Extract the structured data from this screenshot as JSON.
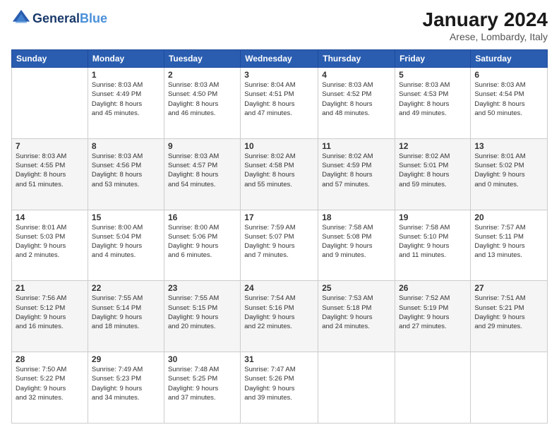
{
  "header": {
    "logo_line1": "General",
    "logo_line2": "Blue",
    "month_title": "January 2024",
    "location": "Arese, Lombardy, Italy"
  },
  "days_of_week": [
    "Sunday",
    "Monday",
    "Tuesday",
    "Wednesday",
    "Thursday",
    "Friday",
    "Saturday"
  ],
  "weeks": [
    [
      {
        "num": "",
        "info": ""
      },
      {
        "num": "1",
        "info": "Sunrise: 8:03 AM\nSunset: 4:49 PM\nDaylight: 8 hours\nand 45 minutes."
      },
      {
        "num": "2",
        "info": "Sunrise: 8:03 AM\nSunset: 4:50 PM\nDaylight: 8 hours\nand 46 minutes."
      },
      {
        "num": "3",
        "info": "Sunrise: 8:04 AM\nSunset: 4:51 PM\nDaylight: 8 hours\nand 47 minutes."
      },
      {
        "num": "4",
        "info": "Sunrise: 8:03 AM\nSunset: 4:52 PM\nDaylight: 8 hours\nand 48 minutes."
      },
      {
        "num": "5",
        "info": "Sunrise: 8:03 AM\nSunset: 4:53 PM\nDaylight: 8 hours\nand 49 minutes."
      },
      {
        "num": "6",
        "info": "Sunrise: 8:03 AM\nSunset: 4:54 PM\nDaylight: 8 hours\nand 50 minutes."
      }
    ],
    [
      {
        "num": "7",
        "info": "Sunrise: 8:03 AM\nSunset: 4:55 PM\nDaylight: 8 hours\nand 51 minutes."
      },
      {
        "num": "8",
        "info": "Sunrise: 8:03 AM\nSunset: 4:56 PM\nDaylight: 8 hours\nand 53 minutes."
      },
      {
        "num": "9",
        "info": "Sunrise: 8:03 AM\nSunset: 4:57 PM\nDaylight: 8 hours\nand 54 minutes."
      },
      {
        "num": "10",
        "info": "Sunrise: 8:02 AM\nSunset: 4:58 PM\nDaylight: 8 hours\nand 55 minutes."
      },
      {
        "num": "11",
        "info": "Sunrise: 8:02 AM\nSunset: 4:59 PM\nDaylight: 8 hours\nand 57 minutes."
      },
      {
        "num": "12",
        "info": "Sunrise: 8:02 AM\nSunset: 5:01 PM\nDaylight: 8 hours\nand 59 minutes."
      },
      {
        "num": "13",
        "info": "Sunrise: 8:01 AM\nSunset: 5:02 PM\nDaylight: 9 hours\nand 0 minutes."
      }
    ],
    [
      {
        "num": "14",
        "info": "Sunrise: 8:01 AM\nSunset: 5:03 PM\nDaylight: 9 hours\nand 2 minutes."
      },
      {
        "num": "15",
        "info": "Sunrise: 8:00 AM\nSunset: 5:04 PM\nDaylight: 9 hours\nand 4 minutes."
      },
      {
        "num": "16",
        "info": "Sunrise: 8:00 AM\nSunset: 5:06 PM\nDaylight: 9 hours\nand 6 minutes."
      },
      {
        "num": "17",
        "info": "Sunrise: 7:59 AM\nSunset: 5:07 PM\nDaylight: 9 hours\nand 7 minutes."
      },
      {
        "num": "18",
        "info": "Sunrise: 7:58 AM\nSunset: 5:08 PM\nDaylight: 9 hours\nand 9 minutes."
      },
      {
        "num": "19",
        "info": "Sunrise: 7:58 AM\nSunset: 5:10 PM\nDaylight: 9 hours\nand 11 minutes."
      },
      {
        "num": "20",
        "info": "Sunrise: 7:57 AM\nSunset: 5:11 PM\nDaylight: 9 hours\nand 13 minutes."
      }
    ],
    [
      {
        "num": "21",
        "info": "Sunrise: 7:56 AM\nSunset: 5:12 PM\nDaylight: 9 hours\nand 16 minutes."
      },
      {
        "num": "22",
        "info": "Sunrise: 7:55 AM\nSunset: 5:14 PM\nDaylight: 9 hours\nand 18 minutes."
      },
      {
        "num": "23",
        "info": "Sunrise: 7:55 AM\nSunset: 5:15 PM\nDaylight: 9 hours\nand 20 minutes."
      },
      {
        "num": "24",
        "info": "Sunrise: 7:54 AM\nSunset: 5:16 PM\nDaylight: 9 hours\nand 22 minutes."
      },
      {
        "num": "25",
        "info": "Sunrise: 7:53 AM\nSunset: 5:18 PM\nDaylight: 9 hours\nand 24 minutes."
      },
      {
        "num": "26",
        "info": "Sunrise: 7:52 AM\nSunset: 5:19 PM\nDaylight: 9 hours\nand 27 minutes."
      },
      {
        "num": "27",
        "info": "Sunrise: 7:51 AM\nSunset: 5:21 PM\nDaylight: 9 hours\nand 29 minutes."
      }
    ],
    [
      {
        "num": "28",
        "info": "Sunrise: 7:50 AM\nSunset: 5:22 PM\nDaylight: 9 hours\nand 32 minutes."
      },
      {
        "num": "29",
        "info": "Sunrise: 7:49 AM\nSunset: 5:23 PM\nDaylight: 9 hours\nand 34 minutes."
      },
      {
        "num": "30",
        "info": "Sunrise: 7:48 AM\nSunset: 5:25 PM\nDaylight: 9 hours\nand 37 minutes."
      },
      {
        "num": "31",
        "info": "Sunrise: 7:47 AM\nSunset: 5:26 PM\nDaylight: 9 hours\nand 39 minutes."
      },
      {
        "num": "",
        "info": ""
      },
      {
        "num": "",
        "info": ""
      },
      {
        "num": "",
        "info": ""
      }
    ]
  ]
}
